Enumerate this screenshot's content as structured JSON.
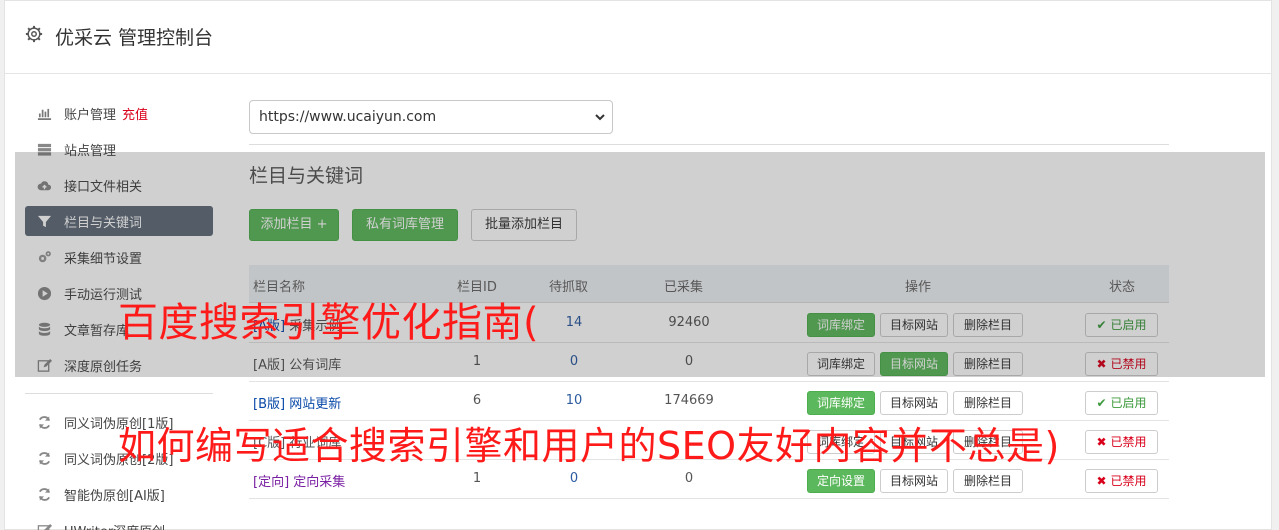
{
  "app": {
    "title": "优采云 管理控制台",
    "icon": "gear-icon"
  },
  "sidebar": {
    "items": [
      {
        "label": "账户管理",
        "extra": "充值",
        "icon": "bar-chart-icon"
      },
      {
        "label": "站点管理",
        "icon": "server-icon"
      },
      {
        "label": "接口文件相关",
        "icon": "cloud-upload-icon"
      },
      {
        "label": "栏目与关键词",
        "icon": "filter-icon",
        "active": true
      },
      {
        "label": "采集细节设置",
        "icon": "gears-icon"
      },
      {
        "label": "手动运行测试",
        "icon": "play-circle-icon"
      },
      {
        "label": "文章暂存库",
        "icon": "database-icon"
      },
      {
        "label": "深度原创任务",
        "icon": "edit-icon"
      },
      {
        "label": "同义词伪原创[1版]",
        "icon": "refresh-icon"
      },
      {
        "label": "同义词伪原创[2版]",
        "icon": "refresh-icon"
      },
      {
        "label": "智能伪原创[AI版]",
        "icon": "refresh-icon"
      },
      {
        "label": "UWriter深度原创",
        "icon": "edit-icon"
      }
    ]
  },
  "main": {
    "site_select": {
      "value": "https://www.ucaiyun.com"
    },
    "section_title": "栏目与关键词",
    "actions": {
      "add_column": "添加栏目 +",
      "private_lib": "私有词库管理",
      "batch_add": "批量添加栏目"
    },
    "table": {
      "headers": {
        "name": "栏目名称",
        "id": "栏目ID",
        "pending": "待抓取",
        "collected": "已采集",
        "ops": "操作",
        "status": "状态"
      },
      "rows": [
        {
          "prefix": "[A版]",
          "name": "采集示例",
          "id": "",
          "pending": "14",
          "collected": "92460",
          "op1": "词库绑定",
          "op2": "目标网站",
          "op3": "删除栏目",
          "status": "已启用"
        },
        {
          "prefix": "[A版]",
          "name": "公有词库",
          "id": "1",
          "pending": "0",
          "collected": "0",
          "op1": "词库绑定",
          "op2": "目标网站",
          "op3": "删除栏目",
          "status": "已禁用"
        },
        {
          "prefix": "[B版]",
          "name": "网站更新",
          "id": "6",
          "pending": "10",
          "collected": "174669",
          "op1": "词库绑定",
          "op2": "目标网站",
          "op3": "删除栏目",
          "status": "已启用"
        },
        {
          "prefix": "[C版]",
          "name": "行业词库",
          "id": "",
          "pending": "",
          "collected": "",
          "op1": "词库绑定",
          "op2": "目标网站",
          "op3": "删除栏目",
          "status": "已禁用"
        },
        {
          "prefix": "[定向]",
          "name": "定向采集",
          "id": "1",
          "pending": "0",
          "collected": "0",
          "op1": "定向设置",
          "op2": "目标网站",
          "op3": "删除栏目",
          "status": "已禁用"
        }
      ]
    }
  },
  "watermark": {
    "line1": "百度搜索引擎优化指南(",
    "line2": "如何编写适合搜索引擎和用户的SEO友好内容并不总是)"
  },
  "colors": {
    "accent_green": "#5cb85c",
    "active_sidebar": "#5f6b79",
    "danger_red": "#d9001b",
    "watermark_red": "#ff1a1a"
  }
}
